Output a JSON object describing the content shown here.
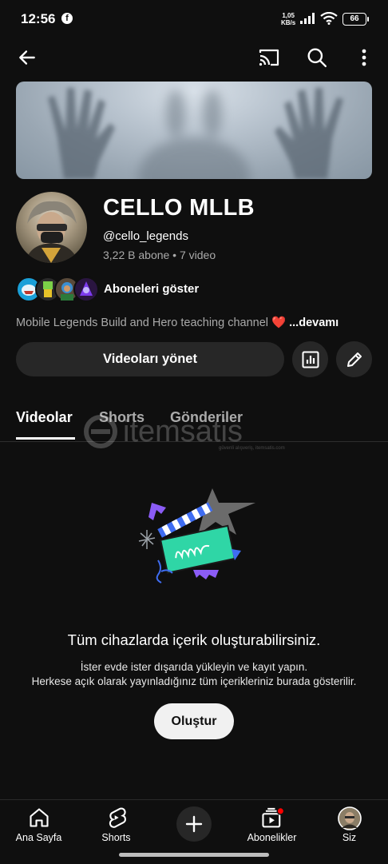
{
  "status_bar": {
    "time": "12:56",
    "network_speed_value": "1,05",
    "network_speed_unit": "KB/s",
    "battery": "66"
  },
  "top_bar": {
    "back_icon": "arrow-left-icon",
    "cast_icon": "cast-icon",
    "search_icon": "search-icon",
    "more_icon": "more-vertical-icon"
  },
  "channel": {
    "name": "CELLO MLLB",
    "handle": "@cello_legends",
    "stats": "3,22 B abone • 7 video",
    "subscribers_label": "Aboneleri göster",
    "description": "Mobile Legends Build and Hero teaching channel",
    "description_more": "...devamı",
    "manage_videos_label": "Videoları yönet"
  },
  "tabs": [
    {
      "label": "Videolar",
      "active": true
    },
    {
      "label": "Shorts",
      "active": false
    },
    {
      "label": "Gönderiler",
      "active": false
    }
  ],
  "watermark": {
    "text": "itemsatis",
    "tagline": "güvenli alışveriş, itemsatis.com"
  },
  "empty_state": {
    "title": "Tüm cihazlarda içerik oluşturabilirsiniz.",
    "line1": "İster evde ister dışarıda yükleyin ve kayıt yapın.",
    "line2": "Herkese açık olarak yayınladığınız tüm içerikleriniz burada gösterilir.",
    "create_label": "Oluştur"
  },
  "bottom_nav": {
    "home": "Ana Sayfa",
    "shorts": "Shorts",
    "subscriptions": "Abonelikler",
    "you": "Siz"
  },
  "colors": {
    "background": "#0f0f0f",
    "chip": "#272727",
    "accent_red": "#ff0000",
    "illustration_green": "#2fd6a6",
    "illustration_blue": "#3f6df2",
    "illustration_purple": "#8b5cf6"
  }
}
